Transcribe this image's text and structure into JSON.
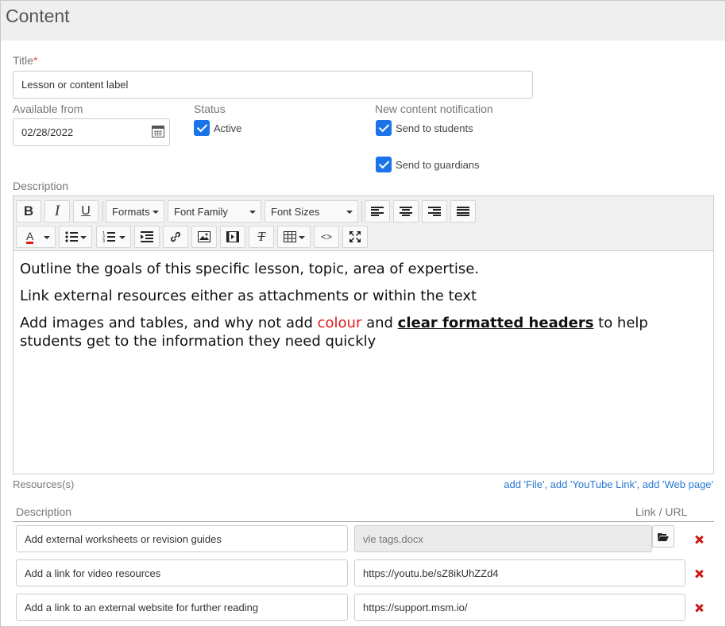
{
  "header": {
    "title": "Content"
  },
  "form": {
    "title_label": "Title",
    "required_mark": "*",
    "title_value": "Lesson or content label",
    "available_label": "Available from",
    "available_value": "02/28/2022",
    "status_label": "Status",
    "active_label": "Active",
    "notif_label": "New content notification",
    "send_students": "Send to students",
    "send_guardians": "Send to guardians",
    "description_label": "Description"
  },
  "toolbar": {
    "bold": "B",
    "italic": "I",
    "underline": "U",
    "formats": "Formats",
    "font_family": "Font Family",
    "font_sizes": "Font Sizes",
    "text_color": "A",
    "clear": "T",
    "code": "<>"
  },
  "editor": {
    "line1": "Outline the goals of this specific lesson, topic, area of expertise.",
    "line2": "Link external resources either as attachments or within the text",
    "line3_a": "Add images and tables, and why not add ",
    "line3_red": "colour",
    "line3_b": " and ",
    "line3_bold": "clear formatted headers",
    "line3_c": " to help students get to the information they need quickly"
  },
  "resources": {
    "label": "Resources(s)",
    "add_links": "add 'File', add 'YouTube Link', add 'Web page'",
    "col_description": "Description",
    "col_link": "Link / URL",
    "rows": [
      {
        "description": "Add external worksheets or revision guides",
        "link": "vle tags.docx"
      },
      {
        "description": "Add a link for video resources",
        "link": "https://youtu.be/sZ8ikUhZZd4"
      },
      {
        "description": "Add a link to an external website for further reading",
        "link": "https://support.msm.io/"
      }
    ]
  },
  "colors": {
    "accent": "#1a73e8",
    "link": "#2a7ad2",
    "delete": "#d01515",
    "highlight_red": "#e01b1b"
  }
}
